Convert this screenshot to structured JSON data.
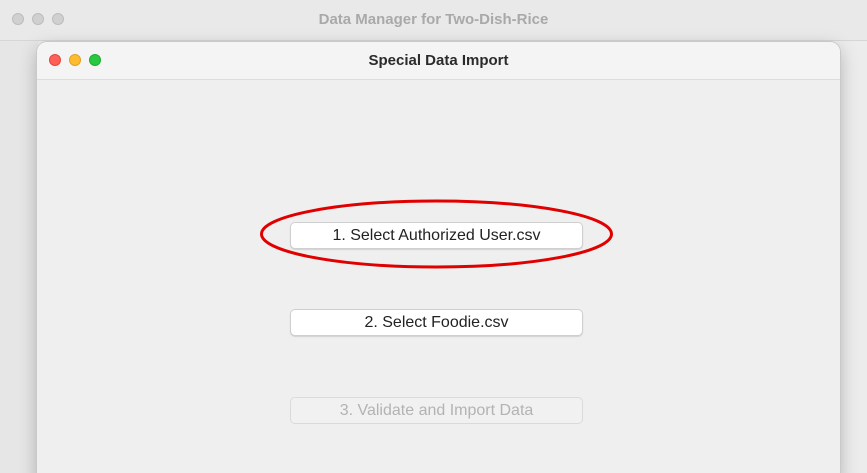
{
  "background_window": {
    "title": "Data Manager for Two-Dish-Rice"
  },
  "dialog": {
    "title": "Special Data Import",
    "buttons": [
      {
        "label": "1. Select Authorized User.csv",
        "enabled": true
      },
      {
        "label": "2. Select Foodie.csv",
        "enabled": true
      },
      {
        "label": "3. Validate and Import Data",
        "enabled": false
      }
    ]
  },
  "colors": {
    "traffic_red": "#fe5f57",
    "traffic_yellow": "#febc2e",
    "traffic_green": "#28c840",
    "annotation_red": "#e00000"
  },
  "annotation": {
    "shape": "ellipse",
    "target": "1. Select Authorized User.csv"
  }
}
